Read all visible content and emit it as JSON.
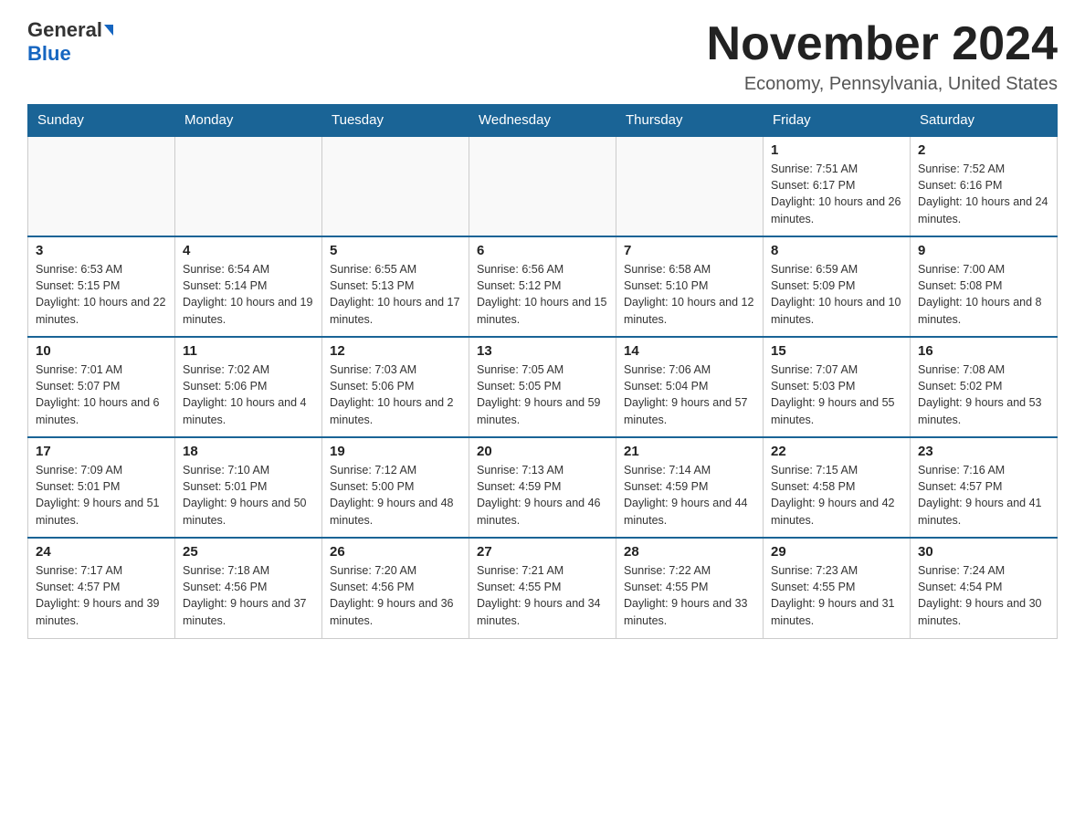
{
  "logo": {
    "general": "General",
    "blue": "Blue"
  },
  "header": {
    "title": "November 2024",
    "location": "Economy, Pennsylvania, United States"
  },
  "days_of_week": [
    "Sunday",
    "Monday",
    "Tuesday",
    "Wednesday",
    "Thursday",
    "Friday",
    "Saturday"
  ],
  "weeks": [
    [
      {
        "day": "",
        "info": ""
      },
      {
        "day": "",
        "info": ""
      },
      {
        "day": "",
        "info": ""
      },
      {
        "day": "",
        "info": ""
      },
      {
        "day": "",
        "info": ""
      },
      {
        "day": "1",
        "info": "Sunrise: 7:51 AM\nSunset: 6:17 PM\nDaylight: 10 hours and 26 minutes."
      },
      {
        "day": "2",
        "info": "Sunrise: 7:52 AM\nSunset: 6:16 PM\nDaylight: 10 hours and 24 minutes."
      }
    ],
    [
      {
        "day": "3",
        "info": "Sunrise: 6:53 AM\nSunset: 5:15 PM\nDaylight: 10 hours and 22 minutes."
      },
      {
        "day": "4",
        "info": "Sunrise: 6:54 AM\nSunset: 5:14 PM\nDaylight: 10 hours and 19 minutes."
      },
      {
        "day": "5",
        "info": "Sunrise: 6:55 AM\nSunset: 5:13 PM\nDaylight: 10 hours and 17 minutes."
      },
      {
        "day": "6",
        "info": "Sunrise: 6:56 AM\nSunset: 5:12 PM\nDaylight: 10 hours and 15 minutes."
      },
      {
        "day": "7",
        "info": "Sunrise: 6:58 AM\nSunset: 5:10 PM\nDaylight: 10 hours and 12 minutes."
      },
      {
        "day": "8",
        "info": "Sunrise: 6:59 AM\nSunset: 5:09 PM\nDaylight: 10 hours and 10 minutes."
      },
      {
        "day": "9",
        "info": "Sunrise: 7:00 AM\nSunset: 5:08 PM\nDaylight: 10 hours and 8 minutes."
      }
    ],
    [
      {
        "day": "10",
        "info": "Sunrise: 7:01 AM\nSunset: 5:07 PM\nDaylight: 10 hours and 6 minutes."
      },
      {
        "day": "11",
        "info": "Sunrise: 7:02 AM\nSunset: 5:06 PM\nDaylight: 10 hours and 4 minutes."
      },
      {
        "day": "12",
        "info": "Sunrise: 7:03 AM\nSunset: 5:06 PM\nDaylight: 10 hours and 2 minutes."
      },
      {
        "day": "13",
        "info": "Sunrise: 7:05 AM\nSunset: 5:05 PM\nDaylight: 9 hours and 59 minutes."
      },
      {
        "day": "14",
        "info": "Sunrise: 7:06 AM\nSunset: 5:04 PM\nDaylight: 9 hours and 57 minutes."
      },
      {
        "day": "15",
        "info": "Sunrise: 7:07 AM\nSunset: 5:03 PM\nDaylight: 9 hours and 55 minutes."
      },
      {
        "day": "16",
        "info": "Sunrise: 7:08 AM\nSunset: 5:02 PM\nDaylight: 9 hours and 53 minutes."
      }
    ],
    [
      {
        "day": "17",
        "info": "Sunrise: 7:09 AM\nSunset: 5:01 PM\nDaylight: 9 hours and 51 minutes."
      },
      {
        "day": "18",
        "info": "Sunrise: 7:10 AM\nSunset: 5:01 PM\nDaylight: 9 hours and 50 minutes."
      },
      {
        "day": "19",
        "info": "Sunrise: 7:12 AM\nSunset: 5:00 PM\nDaylight: 9 hours and 48 minutes."
      },
      {
        "day": "20",
        "info": "Sunrise: 7:13 AM\nSunset: 4:59 PM\nDaylight: 9 hours and 46 minutes."
      },
      {
        "day": "21",
        "info": "Sunrise: 7:14 AM\nSunset: 4:59 PM\nDaylight: 9 hours and 44 minutes."
      },
      {
        "day": "22",
        "info": "Sunrise: 7:15 AM\nSunset: 4:58 PM\nDaylight: 9 hours and 42 minutes."
      },
      {
        "day": "23",
        "info": "Sunrise: 7:16 AM\nSunset: 4:57 PM\nDaylight: 9 hours and 41 minutes."
      }
    ],
    [
      {
        "day": "24",
        "info": "Sunrise: 7:17 AM\nSunset: 4:57 PM\nDaylight: 9 hours and 39 minutes."
      },
      {
        "day": "25",
        "info": "Sunrise: 7:18 AM\nSunset: 4:56 PM\nDaylight: 9 hours and 37 minutes."
      },
      {
        "day": "26",
        "info": "Sunrise: 7:20 AM\nSunset: 4:56 PM\nDaylight: 9 hours and 36 minutes."
      },
      {
        "day": "27",
        "info": "Sunrise: 7:21 AM\nSunset: 4:55 PM\nDaylight: 9 hours and 34 minutes."
      },
      {
        "day": "28",
        "info": "Sunrise: 7:22 AM\nSunset: 4:55 PM\nDaylight: 9 hours and 33 minutes."
      },
      {
        "day": "29",
        "info": "Sunrise: 7:23 AM\nSunset: 4:55 PM\nDaylight: 9 hours and 31 minutes."
      },
      {
        "day": "30",
        "info": "Sunrise: 7:24 AM\nSunset: 4:54 PM\nDaylight: 9 hours and 30 minutes."
      }
    ]
  ]
}
